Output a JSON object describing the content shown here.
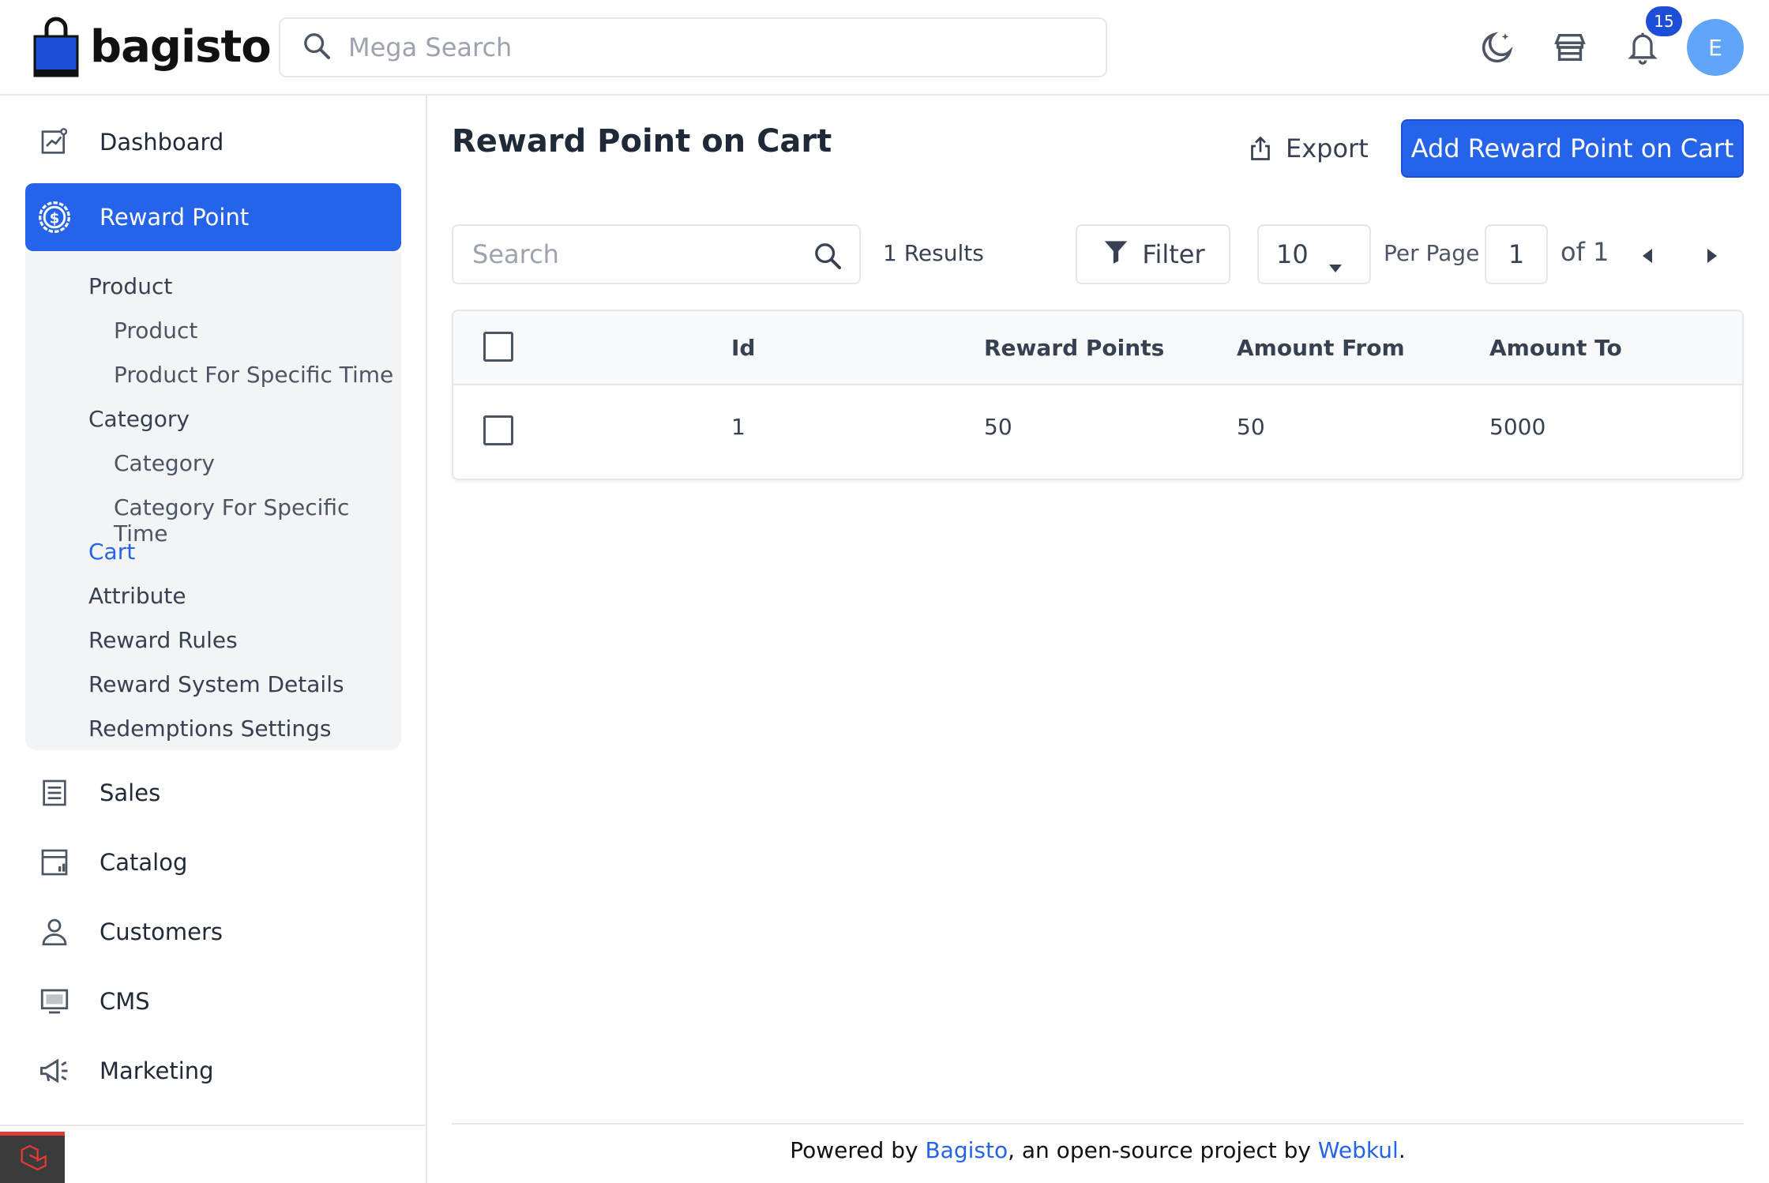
{
  "header": {
    "brand": "bagisto",
    "search_placeholder": "Mega Search",
    "notification_count": "15",
    "avatar_initial": "E"
  },
  "sidebar": {
    "items": [
      {
        "label": "Dashboard",
        "icon": "dashboard-icon"
      },
      {
        "label": "Reward Point",
        "icon": "dollar-circle-icon"
      },
      {
        "label": "Sales",
        "icon": "sales-icon"
      },
      {
        "label": "Catalog",
        "icon": "catalog-icon"
      },
      {
        "label": "Customers",
        "icon": "customer-icon"
      },
      {
        "label": "CMS",
        "icon": "cms-icon"
      },
      {
        "label": "Marketing",
        "icon": "megaphone-icon"
      }
    ],
    "submenu": [
      {
        "label": "Product"
      },
      {
        "label": "Product"
      },
      {
        "label": "Product For Specific Time"
      },
      {
        "label": "Category"
      },
      {
        "label": "Category"
      },
      {
        "label": "Category For Specific Time"
      },
      {
        "label": "Cart"
      },
      {
        "label": "Attribute"
      },
      {
        "label": "Reward Rules"
      },
      {
        "label": "Reward System Details"
      },
      {
        "label": "Redemptions Settings"
      }
    ]
  },
  "main": {
    "title": "Reward Point on Cart",
    "export_label": "Export",
    "add_label": "Add Reward Point on Cart",
    "search_placeholder": "Search",
    "results": "1 Results",
    "filter_label": "Filter",
    "per_page_value": "10",
    "per_page_label": "Per Page",
    "current_page": "1",
    "total_pages_label": "of 1"
  },
  "table": {
    "columns": [
      "Id",
      "Reward Points",
      "Amount From",
      "Amount To"
    ],
    "rows": [
      [
        "1",
        "50",
        "50",
        "5000"
      ]
    ]
  },
  "footer": {
    "prefix": "Powered by ",
    "link1": "Bagisto",
    "middle": ", an open-source project by ",
    "link2": "Webkul",
    "suffix": "."
  },
  "colors": {
    "accent": "#2563eb",
    "sidebar_submenu_bg": "#f3f4f6",
    "border": "#e5e7eb"
  }
}
